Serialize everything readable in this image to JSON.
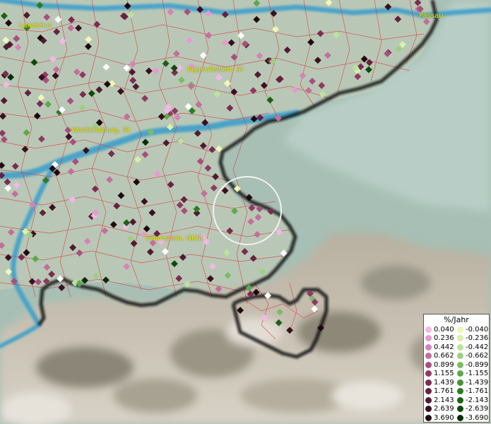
{
  "map": {
    "cities": [
      {
        "label": "Landshut"
      },
      {
        "label": "Passau"
      },
      {
        "label": "Eggenfelden, St"
      },
      {
        "label": "Waldkraiburg, St"
      },
      {
        "label": "Traunstein, GKSt"
      }
    ]
  },
  "legend": {
    "title": "%/Jahr",
    "positive": [
      {
        "value": "0.040",
        "color": "#f2b8e6"
      },
      {
        "value": "0.236",
        "color": "#e79ad0"
      },
      {
        "value": "0.442",
        "color": "#d783b8"
      },
      {
        "value": "0.662",
        "color": "#c46e9c"
      },
      {
        "value": "0.899",
        "color": "#a84f7e"
      },
      {
        "value": "1.155",
        "color": "#8e3a62"
      },
      {
        "value": "1.439",
        "color": "#7b2c50"
      },
      {
        "value": "1.761",
        "color": "#66223f"
      },
      {
        "value": "2.143",
        "color": "#521a30"
      },
      {
        "value": "2.639",
        "color": "#3a1020"
      },
      {
        "value": "3.690",
        "color": "#200810"
      }
    ],
    "negative": [
      {
        "value": "-0.040",
        "color": "#f0f7b8"
      },
      {
        "value": "-0.236",
        "color": "#d9f0a6"
      },
      {
        "value": "-0.442",
        "color": "#bde39a"
      },
      {
        "value": "-0.662",
        "color": "#9ccf84"
      },
      {
        "value": "-0.899",
        "color": "#7cbc66"
      },
      {
        "value": "-1.155",
        "color": "#5ea84c"
      },
      {
        "value": "-1.439",
        "color": "#449234"
      },
      {
        "value": "-1.761",
        "color": "#2e7a22"
      },
      {
        "value": "-2.143",
        "color": "#1c6214"
      },
      {
        "value": "-2.639",
        "color": "#0e4a0a"
      },
      {
        "value": "-3.690",
        "color": "#042e04"
      }
    ]
  }
}
